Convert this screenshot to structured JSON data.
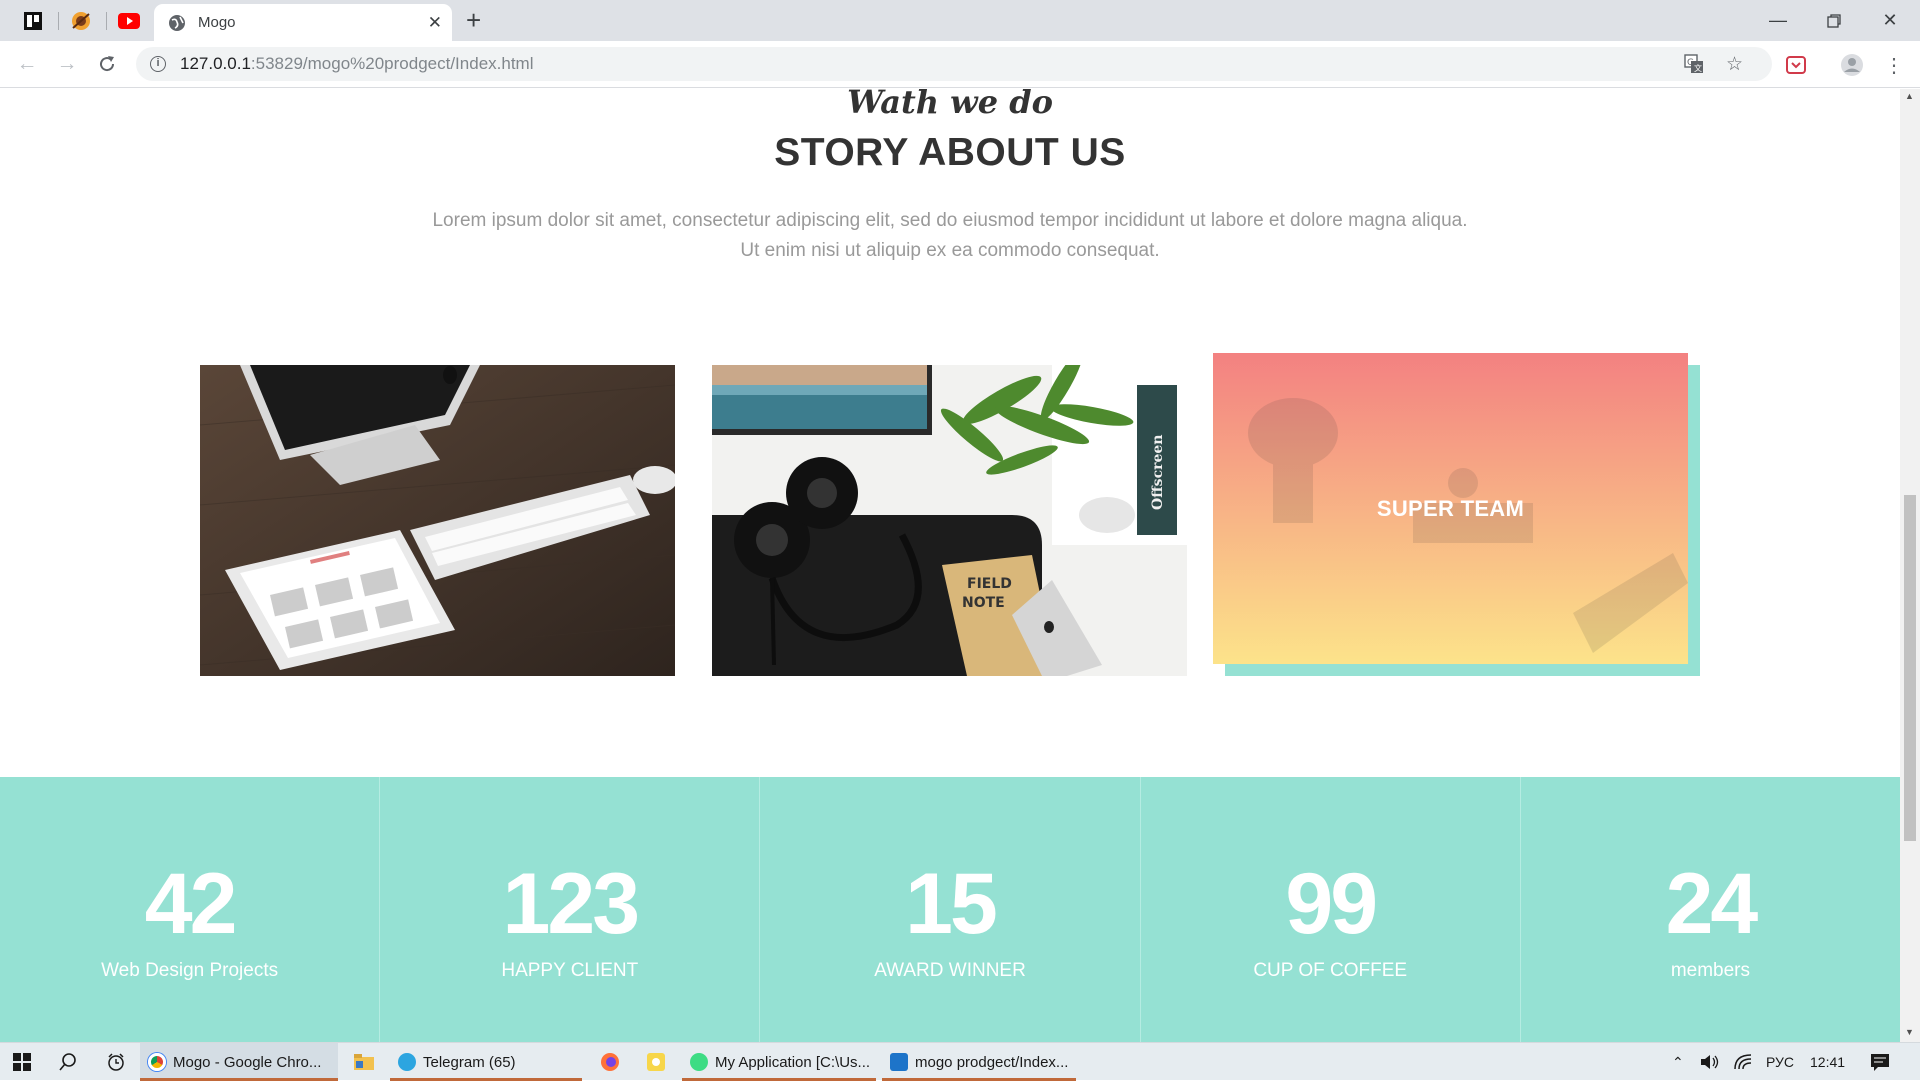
{
  "browser": {
    "tab_title": "Mogo",
    "url_host": "127.0.0.1",
    "url_rest": ":53829/mogo%20prodgect/Index.html"
  },
  "page": {
    "script_title": "Wath we do",
    "title": "STORY ABOUT US",
    "description_line1": "Lorem ipsum dolor sit amet, consectetur adipiscing elit, sed do eiusmod tempor incididunt ut labore et dolore magna aliqua.",
    "description_line2": "Ut enim nisi ut aliquip ex ea commodo consequat.",
    "card_label": "SUPER TEAM",
    "stats": [
      {
        "number": "42",
        "label": "Web Design Projects"
      },
      {
        "number": "123",
        "label": "HAPPY CLIENT"
      },
      {
        "number": "15",
        "label": "AWARD WINNER"
      },
      {
        "number": "99",
        "label": "CUP OF COFFEE"
      },
      {
        "number": "24",
        "label": "members"
      }
    ],
    "colors": {
      "accent": "#95e1d3",
      "gradient_top": "#f38181",
      "gradient_bottom": "#fce38a"
    }
  },
  "taskbar": {
    "apps": [
      {
        "label": "Mogo - Google Chro..."
      },
      {
        "label": "Telegram (65)"
      },
      {
        "label": "My Application [C:\\Us..."
      },
      {
        "label": "mogo prodgect/Index..."
      }
    ],
    "language": "РУС",
    "time": "12:41"
  }
}
